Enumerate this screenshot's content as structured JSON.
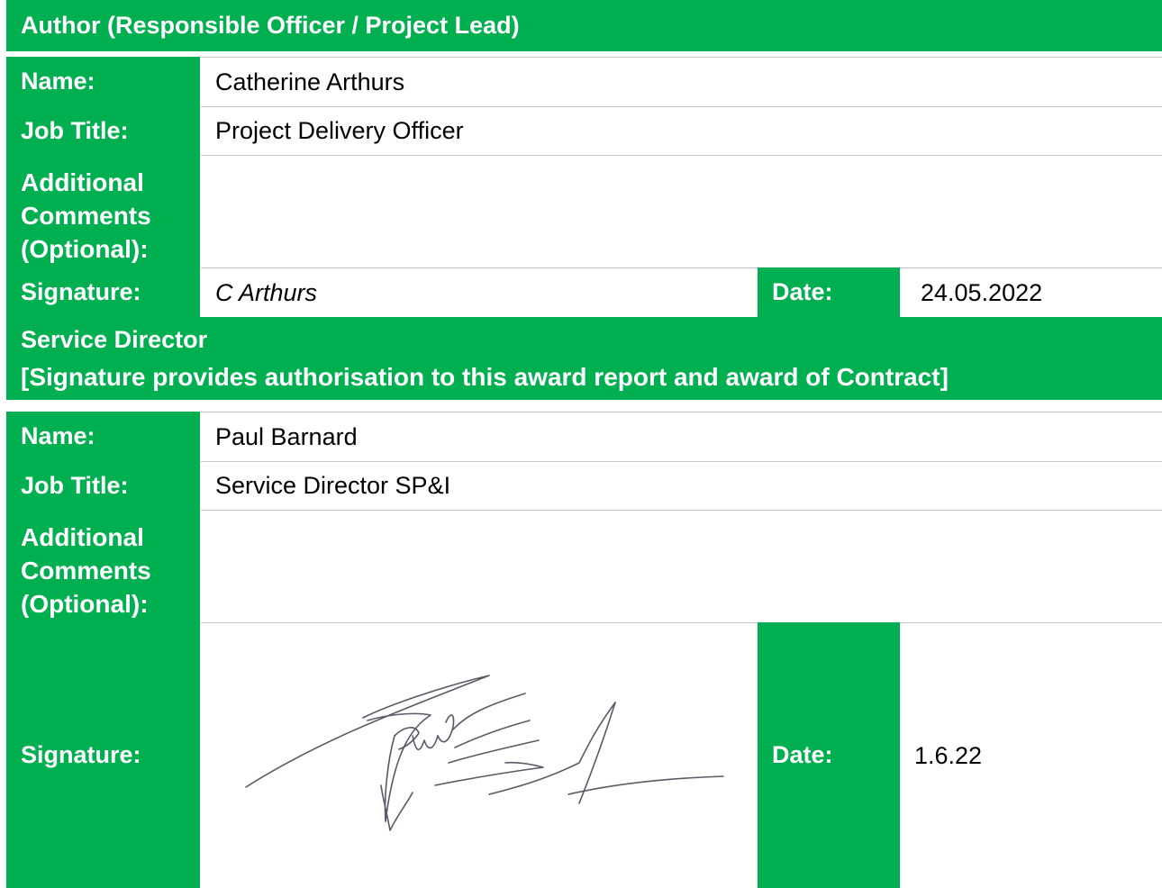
{
  "author_section": {
    "header": "Author (Responsible Officer / Project Lead)",
    "name_label": "Name:",
    "name_value": "Catherine Arthurs",
    "job_title_label": "Job Title:",
    "job_title_value": "Project Delivery Officer",
    "comments_label_line1": "Additional",
    "comments_label_line2": "Comments",
    "comments_label_line3": "(Optional):",
    "comments_value": "",
    "signature_label": "Signature:",
    "signature_value": "C Arthurs",
    "date_label": "Date:",
    "date_value": "24.05.2022"
  },
  "director_section": {
    "header_line1": "Service Director",
    "header_line2": "[Signature provides authorisation to this award report and award of Contract]",
    "name_label": "Name:",
    "name_value": "Paul Barnard",
    "job_title_label": "Job Title:",
    "job_title_value": "Service Director SP&I",
    "comments_label_line1": "Additional",
    "comments_label_line2": "Comments",
    "comments_label_line3": "(Optional):",
    "comments_value": "",
    "signature_label": "Signature:",
    "date_label": "Date:",
    "date_value": "1.6.22"
  },
  "colors": {
    "header_green": "#00b050",
    "label_text": "#ffffff",
    "value_text": "#000000"
  }
}
